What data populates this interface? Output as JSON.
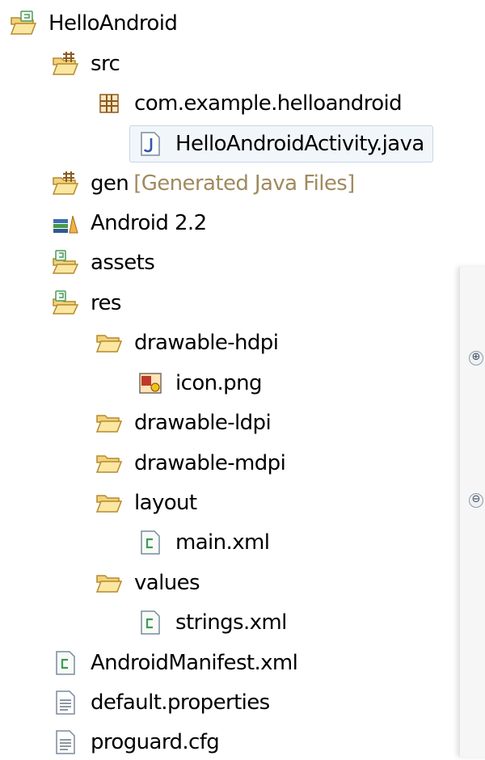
{
  "tree": {
    "project": "HelloAndroid",
    "src": "src",
    "package": "com.example.helloandroid",
    "java_file": "HelloAndroidActivity.java",
    "gen": "gen",
    "gen_decoration": "[Generated Java Files]",
    "android_lib": "Android 2.2",
    "assets": "assets",
    "res": "res",
    "drawable_hdpi": "drawable-hdpi",
    "icon_png": "icon.png",
    "drawable_ldpi": "drawable-ldpi",
    "drawable_mdpi": "drawable-mdpi",
    "layout": "layout",
    "main_xml": "main.xml",
    "values": "values",
    "strings_xml": "strings.xml",
    "manifest": "AndroidManifest.xml",
    "default_properties": "default.properties",
    "proguard": "proguard.cfg"
  },
  "side_panel": {
    "expand_glyph": "⊕",
    "collapse_glyph": "⊖"
  }
}
